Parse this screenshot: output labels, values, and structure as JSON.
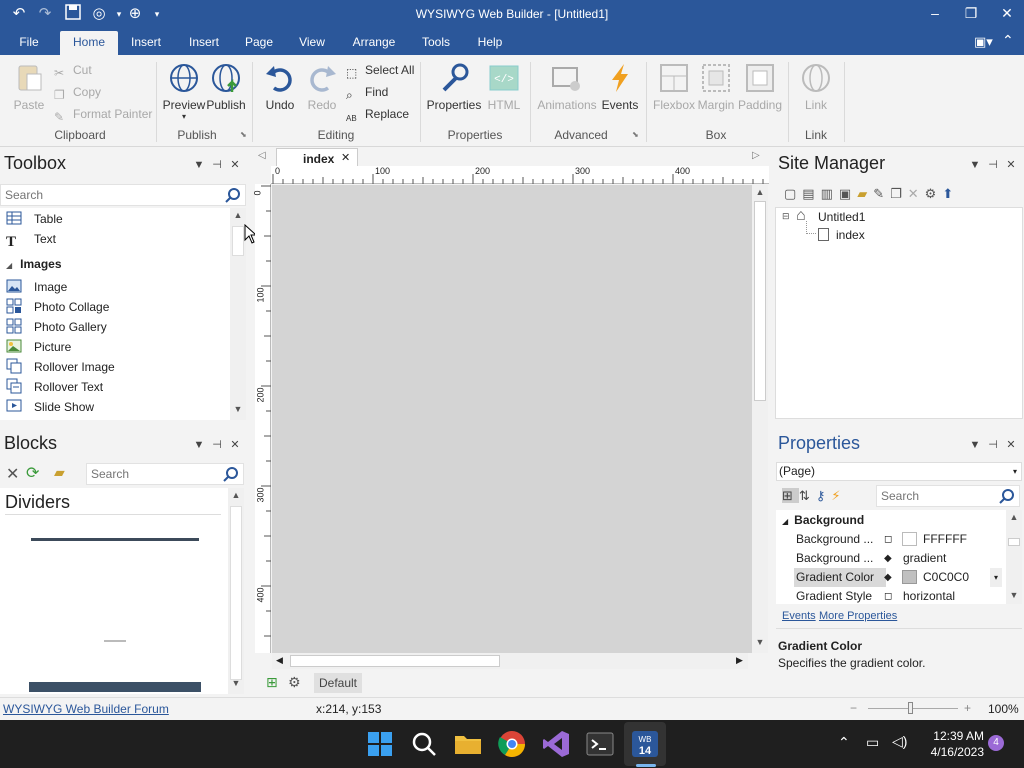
{
  "window": {
    "title": "WYSIWYG Web Builder - [Untitled1]",
    "minimize": "–",
    "restore": "❐",
    "close": "✕"
  },
  "ribbon": {
    "tabs": [
      "File",
      "Home",
      "Insert",
      "Insert",
      "Page",
      "View",
      "Arrange",
      "Tools",
      "Help"
    ],
    "clipboard": {
      "paste": "Paste",
      "cut": "Cut",
      "copy": "Copy",
      "format_painter": "Format Painter",
      "group": "Clipboard"
    },
    "publish": {
      "preview": "Preview",
      "publish": "Publish",
      "group": "Publish"
    },
    "editing": {
      "undo": "Undo",
      "redo": "Redo",
      "select_all": "Select All",
      "find": "Find",
      "replace": "Replace",
      "group": "Editing"
    },
    "properties": {
      "properties": "Properties",
      "html": "HTML",
      "group": "Properties"
    },
    "advanced": {
      "animations": "Animations",
      "events": "Events",
      "group": "Advanced"
    },
    "box": {
      "flexbox": "Flexbox",
      "margin": "Margin",
      "padding": "Padding",
      "group": "Box"
    },
    "link": {
      "link": "Link",
      "group": "Link"
    }
  },
  "toolbox": {
    "title": "Toolbox",
    "search_placeholder": "Search",
    "items_top": [
      "Table",
      "Text"
    ],
    "category": "Images",
    "items": [
      "Image",
      "Photo Collage",
      "Photo Gallery",
      "Picture",
      "Rollover Image",
      "Rollover Text",
      "Slide Show"
    ]
  },
  "blocks": {
    "title": "Blocks",
    "search_placeholder": "Search",
    "section": "Dividers"
  },
  "editor": {
    "tab": "index",
    "ruler_h": [
      "0",
      "100",
      "200",
      "300",
      "400"
    ],
    "ruler_v": [
      "0",
      "100",
      "200",
      "300",
      "400"
    ],
    "layer_label": "Default"
  },
  "site_manager": {
    "title": "Site Manager",
    "root": "Untitled1",
    "page": "index"
  },
  "properties": {
    "title": "Properties",
    "selector": "(Page)",
    "search_placeholder": "Search",
    "category": "Background",
    "rows": [
      {
        "name": "Background ...",
        "value": "FFFFFF"
      },
      {
        "name": "Background ...",
        "value": "gradient"
      },
      {
        "name": "Gradient Color",
        "value": "C0C0C0"
      },
      {
        "name": "Gradient Style",
        "value": "horizontal"
      }
    ],
    "links": {
      "events": "Events",
      "more": "More Properties"
    },
    "help_title": "Gradient Color",
    "help_text": "Specifies the gradient color."
  },
  "statusbar": {
    "link": "WYSIWYG Web Builder Forum",
    "coords": "x:214, y:153",
    "zoom": "100%"
  },
  "taskbar": {
    "time": "12:39 AM",
    "date": "4/16/2023",
    "badge": "4"
  }
}
